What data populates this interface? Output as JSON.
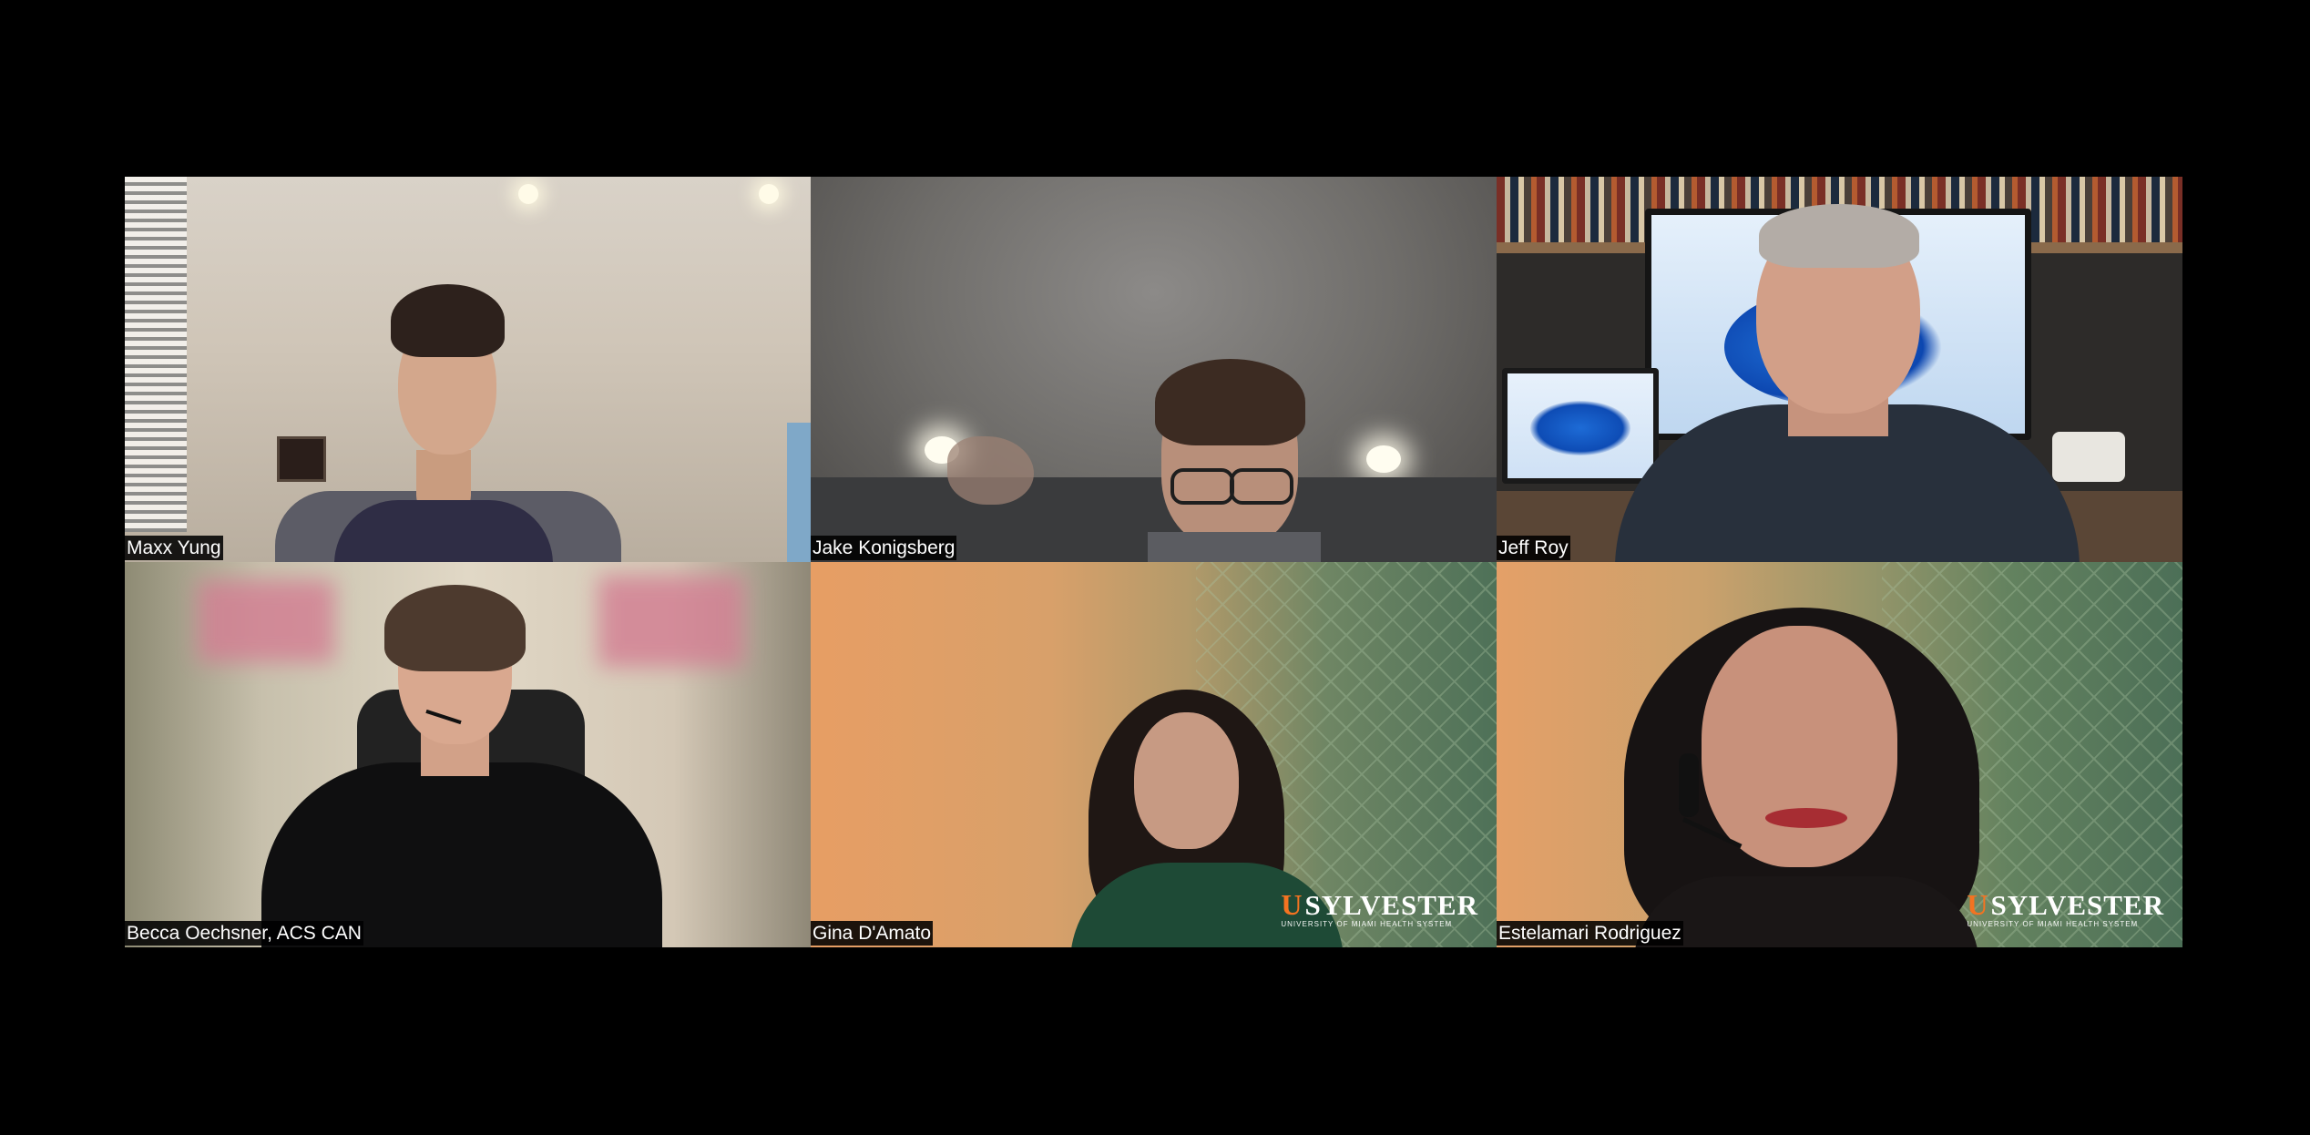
{
  "participants": [
    {
      "name": "Maxx Yung"
    },
    {
      "name": "Jake Konigsberg"
    },
    {
      "name": "Jeff Roy"
    },
    {
      "name": "Becca Oechsner, ACS CAN"
    },
    {
      "name": "Gina D'Amato"
    },
    {
      "name": "Estelamari Rodriguez"
    }
  ],
  "logos": {
    "gina": {
      "letter": "U",
      "main": "SYLVESTER",
      "sub": "UNIVERSITY OF MIAMI HEALTH SYSTEM"
    },
    "estelamari": {
      "letter": "U",
      "main": "SYLVESTER",
      "sub": "UNIVERSITY OF MIAMI HEALTH SYSTEM"
    }
  },
  "colors": {
    "background": "#000000",
    "name_label_bg": "#000000",
    "name_label_text": "#ffffff",
    "logo_accent": "#f47321"
  }
}
